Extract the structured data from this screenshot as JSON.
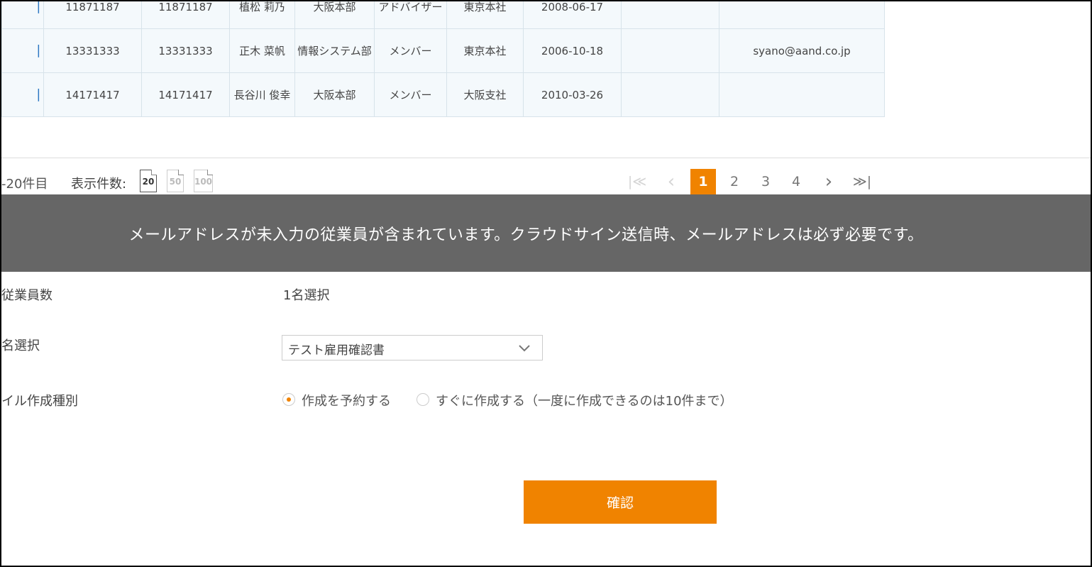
{
  "table": {
    "rows": [
      {
        "link": "",
        "code1": "11871187",
        "code2": "11871187",
        "name": "植松 莉乃",
        "dept": "大阪本部",
        "role": "アドバイザー",
        "office": "東京本社",
        "date": "2008-06-17",
        "extra": "",
        "email": ""
      },
      {
        "link": "",
        "code1": "13331333",
        "code2": "13331333",
        "name": "正木 菜帆",
        "dept": "情報システム部",
        "role": "メンバー",
        "office": "東京本社",
        "date": "2006-10-18",
        "extra": "",
        "email": "syano@aand.co.jp"
      },
      {
        "link": "",
        "code1": "14171417",
        "code2": "14171417",
        "name": "長谷川 俊幸",
        "dept": "大阪本部",
        "role": "メンバー",
        "office": "大阪支社",
        "date": "2010-03-26",
        "extra": "",
        "email": ""
      }
    ]
  },
  "pagination": {
    "range_text": "-20件目",
    "per_page_label": "表示件数:",
    "per_page_options": [
      "20",
      "50",
      "100"
    ],
    "per_page_selected": "20",
    "pages": [
      "1",
      "2",
      "3",
      "4"
    ],
    "current_page": "1",
    "first_symbol": "|≪",
    "prev_symbol": "‹",
    "next_symbol": "›",
    "last_symbol": "≫|"
  },
  "banner": {
    "message": "メールアドレスが未入力の従業員が含まれています。クラウドサイン送信時、メールアドレスは必ず必要です。"
  },
  "form": {
    "employees_label": "従業員数",
    "employees_value": "1名選択",
    "template_label": "名選択",
    "template_value": "テスト雇用確認書",
    "filetype_label": "イル作成種別",
    "option_reserve": "作成を予約する",
    "option_now": "すぐに作成する（一度に作成できるのは10件まで）",
    "selected_option": "reserve",
    "confirm_label": "確認"
  },
  "colors": {
    "accent": "#f08300",
    "banner_bg": "#666666",
    "table_bg": "#f4f9fc"
  }
}
